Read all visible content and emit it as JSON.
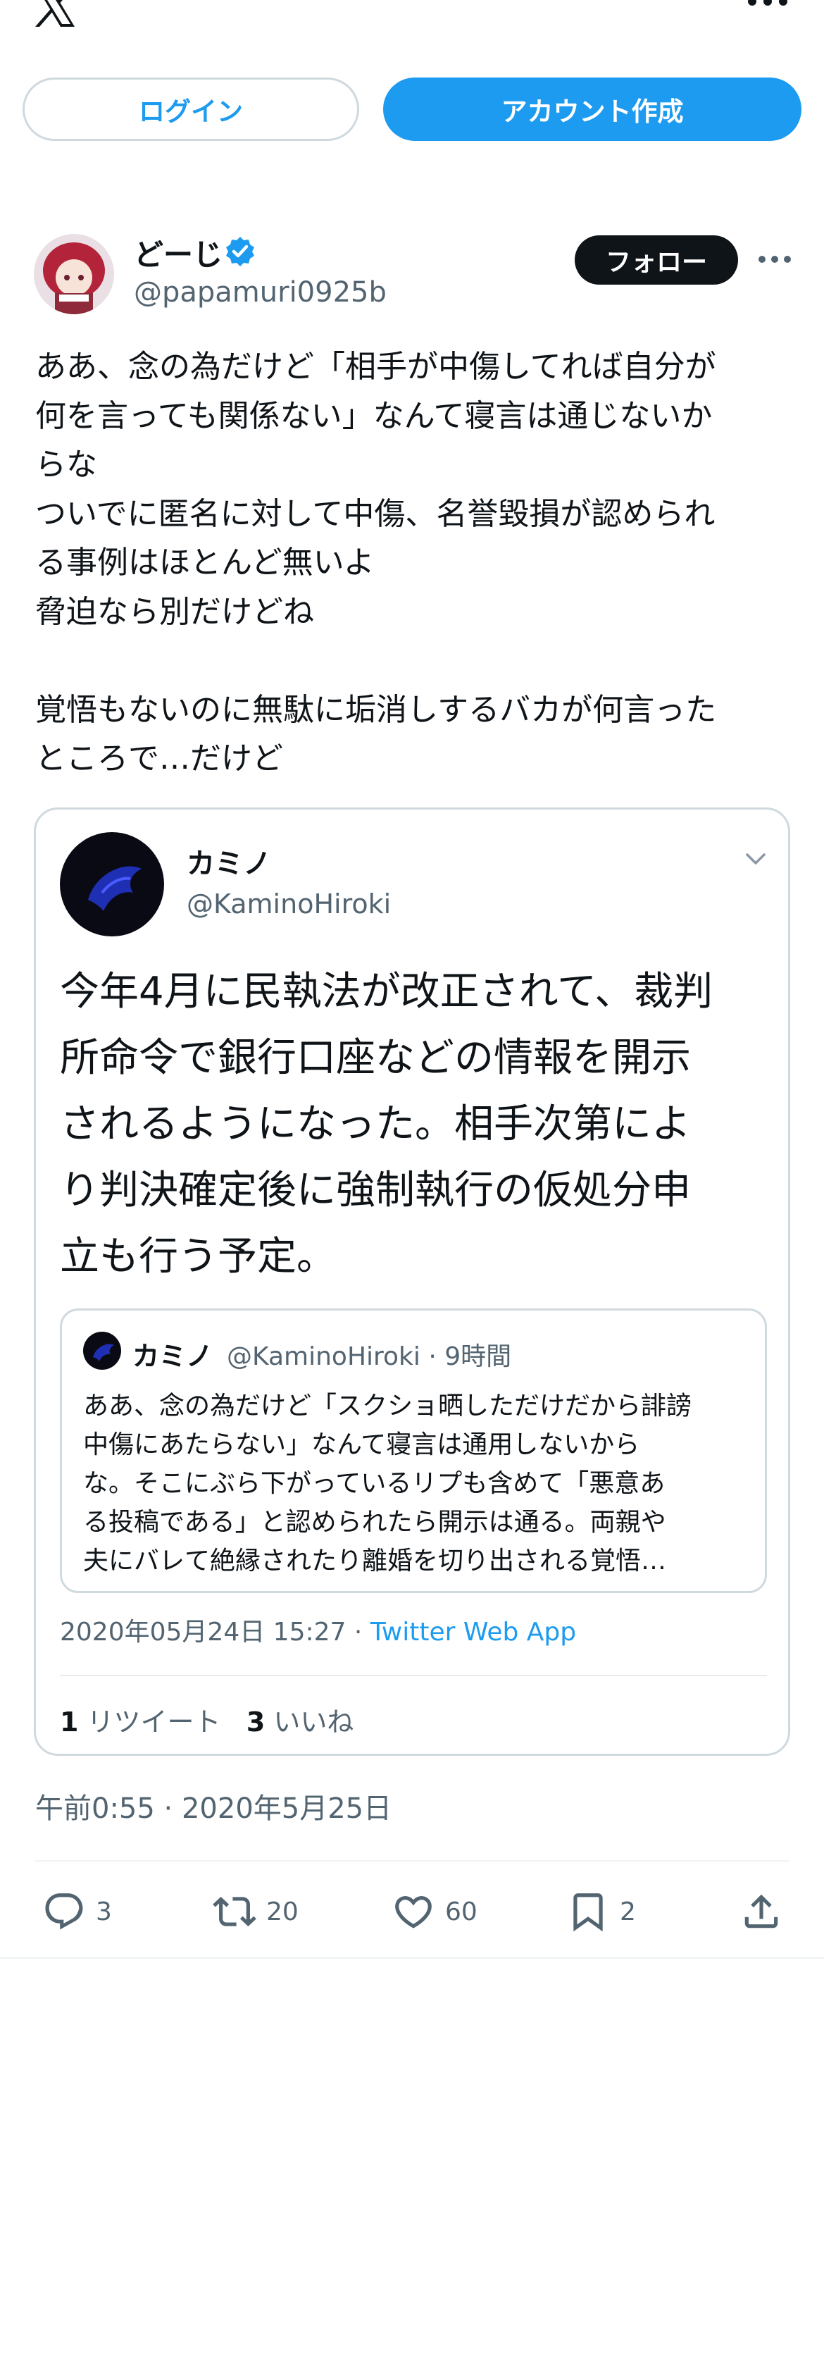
{
  "header": {
    "login_label": "ログイン",
    "signup_label": "アカウント作成"
  },
  "tweet": {
    "author_name": "どーじ",
    "author_handle": "@papamuri0925b",
    "follow_label": "フォロー",
    "text": "ああ、念の為だけど「相手が中傷してれば自分が\n何を言っても関係ない」なんて寝言は通じないか\nらな\nついでに匿名に対して中傷、名誉毀損が認められ\nる事例はほとんど無いよ\n脅迫なら別だけどね\n\n覚悟もないのに無駄に垢消しするバカが何言った\nところで…だけど",
    "timestamp": "午前0:55 · 2020年5月25日"
  },
  "quote": {
    "author_name": "カミノ",
    "author_handle": "@KaminoHiroki",
    "text": "今年4月に民執法が改正されて、裁判\n所命令で銀行口座などの情報を開示\nされるようになった。相手次第によ\nり判決確定後に強制執行の仮処分申\n立も行う予定。",
    "date": "2020年05月24日 15:27 · ",
    "source": "Twitter Web App",
    "retweet_count": "1",
    "retweet_label": "リツイート",
    "like_count": "3",
    "like_label": "いいね",
    "nested": {
      "author_name": "カミノ",
      "meta": "@KaminoHiroki · 9時間",
      "text": "ああ、念の為だけど「スクショ晒しただけだから誹謗\n中傷にあたらない」なんて寝言は通用しないから\nな。そこにぶら下がっているリプも含めて「悪意あ\nる投稿である」と認められたら開示は通る。両親や\n夫にバレて絶縁されたり離婚を切り出される覚悟…"
    }
  },
  "actions": {
    "replies": "3",
    "retweets": "20",
    "likes": "60",
    "bookmarks": "2"
  },
  "colors": {
    "accent": "#1d9bf0",
    "text": "#0f1419",
    "secondary": "#536471",
    "border": "#cfd9de"
  }
}
